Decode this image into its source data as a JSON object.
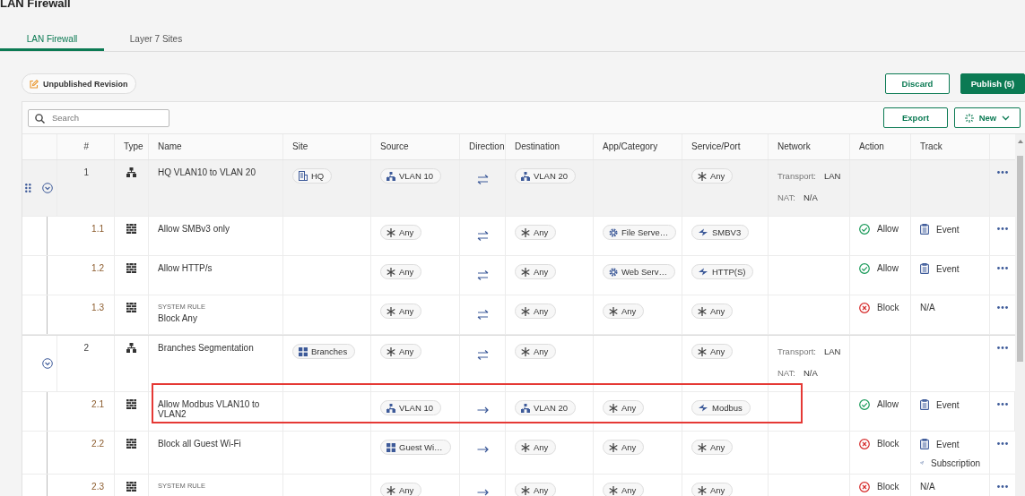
{
  "page_title": "LAN Firewall",
  "tabs": [
    {
      "label": "LAN Firewall",
      "selected": true
    },
    {
      "label": "Layer 7 Sites",
      "selected": false
    }
  ],
  "revision_badge": "Unpublished Revision",
  "buttons": {
    "discard": "Discard",
    "publish": "Publish (5)",
    "export": "Export",
    "new": "New"
  },
  "search": {
    "placeholder": "Search"
  },
  "columns": [
    "#",
    "Type",
    "Name",
    "Site",
    "Source",
    "Direction",
    "Destination",
    "App/Category",
    "Service/Port",
    "Network",
    "Action",
    "Track"
  ],
  "rules": [
    {
      "number": "1",
      "kind": "group",
      "name": "HQ VLAN10 to VLAN 20",
      "hovered": true,
      "expanded": true,
      "site": [
        {
          "kind": "building",
          "label": "HQ"
        }
      ],
      "source": [
        {
          "kind": "network",
          "label": "VLAN 10"
        }
      ],
      "direction": {
        "kind": "both"
      },
      "destination": [
        {
          "kind": "network",
          "label": "VLAN 20"
        }
      ],
      "service": [
        {
          "kind": "any",
          "label": "Any"
        }
      ],
      "network": {
        "transport_label": "Transport:",
        "transport": "LAN",
        "nat_label": "NAT:",
        "nat": "N/A"
      },
      "children": [
        {
          "number": "1.1",
          "kind": "rule",
          "name": "Allow SMBv3 only",
          "highlighted": false,
          "source": [
            {
              "kind": "any",
              "label": "Any"
            }
          ],
          "direction": {
            "kind": "both"
          },
          "destination": [
            {
              "kind": "any",
              "label": "Any"
            }
          ],
          "app": [
            {
              "kind": "app",
              "label": "File Serve…"
            }
          ],
          "service": [
            {
              "kind": "service",
              "label": "SMBV3"
            }
          ],
          "action": {
            "kind": "allow",
            "label": "Allow"
          },
          "track": [
            {
              "kind": "event",
              "label": "Event"
            }
          ]
        },
        {
          "number": "1.2",
          "kind": "rule",
          "name": "Allow HTTP/s",
          "highlighted": false,
          "source": [
            {
              "kind": "any",
              "label": "Any"
            }
          ],
          "direction": {
            "kind": "both"
          },
          "destination": [
            {
              "kind": "any",
              "label": "Any"
            }
          ],
          "app": [
            {
              "kind": "app",
              "label": "Web Serv…"
            }
          ],
          "service": [
            {
              "kind": "service",
              "label": "HTTP(S)"
            }
          ],
          "action": {
            "kind": "allow",
            "label": "Allow"
          },
          "track": [
            {
              "kind": "event",
              "label": "Event"
            }
          ]
        },
        {
          "number": "1.3",
          "kind": "rule",
          "tag": "SYSTEM RULE",
          "name": "Block Any",
          "highlighted": false,
          "source": [
            {
              "kind": "any",
              "label": "Any"
            }
          ],
          "direction": {
            "kind": "both"
          },
          "destination": [
            {
              "kind": "any",
              "label": "Any"
            }
          ],
          "app": [
            {
              "kind": "any",
              "label": "Any"
            }
          ],
          "service": [
            {
              "kind": "any",
              "label": "Any"
            }
          ],
          "action": {
            "kind": "block",
            "label": "Block"
          },
          "track": [
            {
              "kind": "none",
              "label": "N/A"
            }
          ]
        }
      ]
    },
    {
      "number": "2",
      "kind": "group",
      "name": "Branches Segmentation",
      "hovered": false,
      "expanded": true,
      "site": [
        {
          "kind": "group",
          "label": "Branches"
        }
      ],
      "source": [
        {
          "kind": "any",
          "label": "Any"
        }
      ],
      "direction": {
        "kind": "both"
      },
      "destination": [
        {
          "kind": "any",
          "label": "Any"
        }
      ],
      "service": [
        {
          "kind": "any",
          "label": "Any"
        }
      ],
      "network": {
        "transport_label": "Transport:",
        "transport": "LAN",
        "nat_label": "NAT:",
        "nat": "N/A"
      },
      "children": [
        {
          "number": "2.1",
          "kind": "rule",
          "name": "Allow Modbus VLAN10 to VLAN2",
          "highlighted": true,
          "source": [
            {
              "kind": "network",
              "label": "VLAN 10"
            }
          ],
          "direction": {
            "kind": "one"
          },
          "destination": [
            {
              "kind": "network",
              "label": "VLAN 20"
            }
          ],
          "app": [
            {
              "kind": "any",
              "label": "Any"
            }
          ],
          "service": [
            {
              "kind": "service",
              "label": "Modbus"
            }
          ],
          "action": {
            "kind": "allow",
            "label": "Allow"
          },
          "track": [
            {
              "kind": "event",
              "label": "Event"
            }
          ]
        },
        {
          "number": "2.2",
          "kind": "rule",
          "name": "Block all Guest Wi-Fi",
          "highlighted": false,
          "source": [
            {
              "kind": "group",
              "label": "Guest Wi…"
            }
          ],
          "direction": {
            "kind": "one"
          },
          "destination": [
            {
              "kind": "any",
              "label": "Any"
            }
          ],
          "app": [
            {
              "kind": "any",
              "label": "Any"
            }
          ],
          "service": [
            {
              "kind": "any",
              "label": "Any"
            }
          ],
          "action": {
            "kind": "block",
            "label": "Block"
          },
          "track": [
            {
              "kind": "event",
              "label": "Event"
            },
            {
              "kind": "subscription",
              "label": "Subscription"
            }
          ]
        },
        {
          "number": "2.3",
          "kind": "rule",
          "tag": "SYSTEM RULE",
          "highlighted": false,
          "source": [
            {
              "kind": "any",
              "label": "Any"
            }
          ],
          "direction": {
            "kind": "one"
          },
          "destination": [
            {
              "kind": "any",
              "label": "Any"
            }
          ],
          "app": [
            {
              "kind": "any",
              "label": "Any"
            }
          ],
          "service": [
            {
              "kind": "any",
              "label": "Any"
            }
          ],
          "action": {
            "kind": "block",
            "label": "Block"
          },
          "track": [
            {
              "kind": "none",
              "label": "N/A"
            }
          ]
        }
      ]
    }
  ]
}
